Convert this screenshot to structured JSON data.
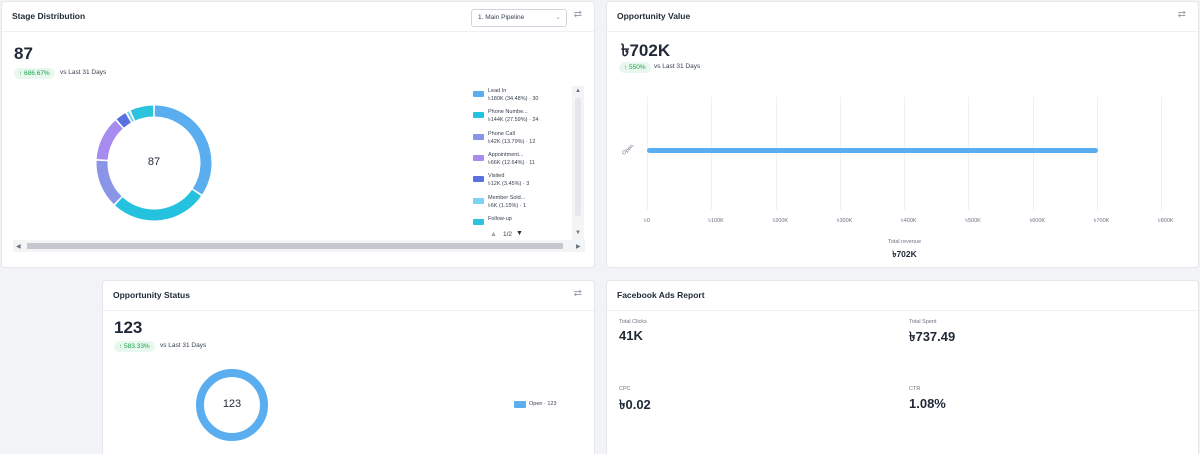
{
  "stage_distribution": {
    "title": "Stage Distribution",
    "pipeline_select": "1. Main Pipeline",
    "total": "87",
    "change": "↑ 686.67%",
    "vs_label": "vs Last 31 Days",
    "center_label": "87",
    "pager": "1/2",
    "legend": [
      {
        "name": "Lead In",
        "value": "৳180K (34.48%) · 30",
        "color": "#5aaef0"
      },
      {
        "name": "Phone Numbe...",
        "value": "৳144K (27.59%) · 24",
        "color": "#25c2e0"
      },
      {
        "name": "Phone Call",
        "value": "৳42K (13.79%) · 12",
        "color": "#8a95e8"
      },
      {
        "name": "Appointment...",
        "value": "৳66K (12.64%) · 11",
        "color": "#a78bf0"
      },
      {
        "name": "Visited",
        "value": "৳12K (3.45%) · 3",
        "color": "#5a6fe0"
      },
      {
        "name": "Member Sold...",
        "value": "৳6K (1.15%) · 1",
        "color": "#7dd3f5"
      },
      {
        "name": "Follow-up",
        "value": "",
        "color": "#2bc4dc"
      }
    ]
  },
  "opportunity_value": {
    "title": "Opportunity Value",
    "total": "৳702K",
    "change": "↑ 550%",
    "vs_label": "vs Last 31 Days",
    "y_category": "Open",
    "x_ticks": [
      "৳0",
      "৳100K",
      "৳200K",
      "৳300K",
      "৳400K",
      "৳500K",
      "৳600K",
      "৳700K",
      "৳800K"
    ],
    "footer_label": "Total revenue",
    "footer_value": "৳702K"
  },
  "opportunity_status": {
    "title": "Opportunity Status",
    "total": "123",
    "change": "↑ 583.33%",
    "vs_label": "vs Last 31 Days",
    "center_label": "123",
    "legend_label": "Open · 123",
    "legend_color": "#5aaef0"
  },
  "facebook_ads": {
    "title": "Facebook Ads Report",
    "metrics": [
      {
        "label": "Total Clicks",
        "value": "41K"
      },
      {
        "label": "Total Spent",
        "value": "৳737.49"
      },
      {
        "label": "CPC",
        "value": "৳0.02"
      },
      {
        "label": "CTR",
        "value": "1.08%"
      }
    ]
  },
  "chart_data": [
    {
      "type": "pie",
      "categories": [
        "Lead In",
        "Phone Numbe...",
        "Phone Call",
        "Appointment...",
        "Visited",
        "Member Sold...",
        "Follow-up"
      ],
      "values": [
        30,
        24,
        12,
        11,
        3,
        1,
        6
      ],
      "colors": [
        "#5aaef0",
        "#25c2e0",
        "#8a95e8",
        "#a78bf0",
        "#5a6fe0",
        "#7dd3f5",
        "#2bc4dc"
      ],
      "donut": true
    },
    {
      "type": "bar",
      "orientation": "horizontal",
      "categories": [
        "Open"
      ],
      "values": [
        702000
      ],
      "xlim": [
        0,
        800000
      ],
      "xlabel": "Total revenue",
      "color": "#5aaef0"
    },
    {
      "type": "pie",
      "categories": [
        "Open"
      ],
      "values": [
        123
      ],
      "colors": [
        "#5aaef0"
      ],
      "donut": true
    }
  ]
}
